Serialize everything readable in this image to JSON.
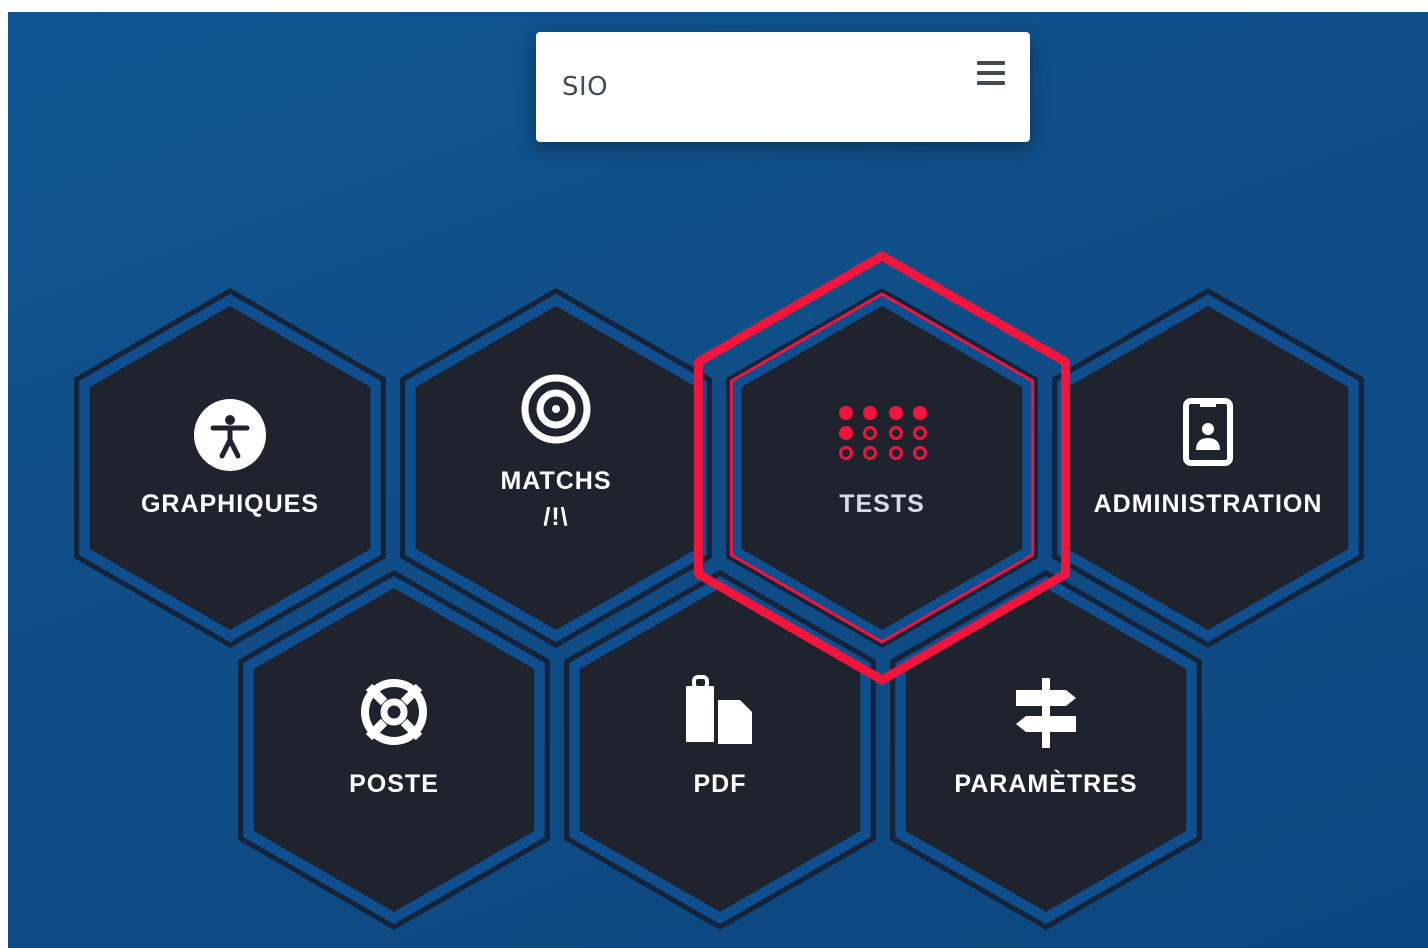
{
  "header": {
    "brand": "SIO",
    "menu_icon": "hamburger-menu-icon"
  },
  "tiles": [
    {
      "id": "graphiques",
      "lines": [
        "GRAPHIQUES"
      ],
      "icon": "accessibility-icon",
      "selected": false
    },
    {
      "id": "matchs",
      "lines": [
        "MATCHS",
        "/!\\"
      ],
      "icon": "target-icon",
      "selected": false
    },
    {
      "id": "tests",
      "lines": [
        "TESTS"
      ],
      "icon": "dot-grid-icon",
      "selected": true
    },
    {
      "id": "administration",
      "lines": [
        "ADMINISTRATION"
      ],
      "icon": "id-badge-icon",
      "selected": false
    },
    {
      "id": "poste",
      "lines": [
        "POSTE"
      ],
      "icon": "life-ring-icon",
      "selected": false
    },
    {
      "id": "pdf",
      "lines": [
        "PDF"
      ],
      "icon": "paste-icon",
      "selected": false
    },
    {
      "id": "parametres",
      "lines": [
        "PARAMÈTRES"
      ],
      "icon": "signpost-icon",
      "selected": false
    }
  ],
  "colors": {
    "background": "#0f5591",
    "tile_fill": "#1f232e",
    "tile_border_outer": "#15233a",
    "tile_border_inner": "#0f4f90",
    "selected_accent": "#f0153c",
    "label": "#ffffff",
    "selected_label": "#d6dbe6"
  }
}
